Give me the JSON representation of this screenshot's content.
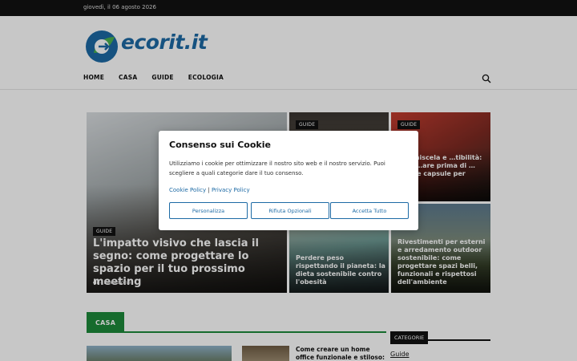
{
  "topbar": {
    "date": "giovedì, il 06 agosto 2026"
  },
  "header": {
    "logo_text": "ecorit.it",
    "nav": [
      "HOME",
      "CASA",
      "GUIDE",
      "ECOLOGIA"
    ],
    "search_icon": "search-icon"
  },
  "featured": {
    "big": {
      "badge": "GUIDE",
      "title": "L'impatto visivo che lascia il segno: come progettare lo spazio per il tuo prossimo meeting",
      "by_label": "di",
      "author": "- Redazione"
    },
    "tile2": {
      "badge": "GUIDE"
    },
    "tile3": {
      "badge": "GUIDE",
      "title": "…à, miscela e …tibilità: cosa …are prima di …tere le capsule per"
    },
    "tile4": {
      "title": "Perdere peso rispettando il pianeta: la dieta sostenibile contro l'obesità"
    },
    "tile5": {
      "title": "Rivestimenti per esterni e arredamento outdoor sostenibile: come progettare spazi belli, funzionali e rispettosi dell'ambiente"
    }
  },
  "section": {
    "title": "CASA"
  },
  "sidebar": {
    "title": "CATEGORIE",
    "first_link": "Guide"
  },
  "post_preview": {
    "title": "Come creare un home office funzionale e stiloso: consigli"
  },
  "cookie_modal": {
    "title": "Consenso sui Cookie",
    "description": "Utilizziamo i cookie per ottimizzare il nostro sito web e il nostro servizio. Puoi scegliere a quali categorie dare il tuo consenso.",
    "cookie_policy": "Cookie Policy",
    "separator": "|",
    "privacy_policy": "Privacy Policy",
    "buttons": [
      "Personalizza",
      "Rifiuta Opzionali",
      "Accetta Tutto"
    ]
  },
  "colors": {
    "brand_blue": "#1d6aa5",
    "brand_green": "#1d8a3a",
    "topbar": "#111111"
  }
}
